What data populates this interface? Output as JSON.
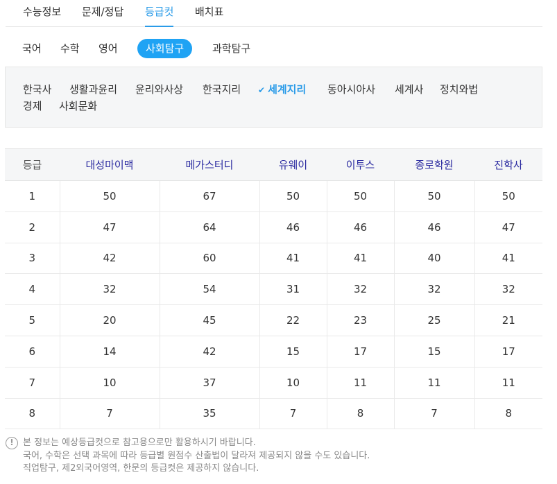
{
  "top_tabs": [
    "수능정보",
    "문제/정답",
    "등급컷",
    "배치표"
  ],
  "active_top_tab": "등급컷",
  "subjects": [
    "국어",
    "수학",
    "영어",
    "사회탐구",
    "과학탐구"
  ],
  "active_subject": "사회탐구",
  "sub_subjects": [
    "한국사",
    "생활과윤리",
    "윤리와사상",
    "한국지리",
    "세계지리",
    "동아시아사",
    "세계사",
    "정치와법",
    "경제",
    "사회문화"
  ],
  "active_sub_subject": "세계지리",
  "check_icon": "✔",
  "table": {
    "headers": [
      "등급",
      "대성마이맥",
      "메가스터디",
      "유웨이",
      "이투스",
      "종로학원",
      "진학사"
    ],
    "rows": [
      [
        "1",
        "50",
        "67",
        "50",
        "50",
        "50",
        "50"
      ],
      [
        "2",
        "47",
        "64",
        "46",
        "46",
        "46",
        "47"
      ],
      [
        "3",
        "42",
        "60",
        "41",
        "41",
        "40",
        "41"
      ],
      [
        "4",
        "32",
        "54",
        "31",
        "32",
        "32",
        "32"
      ],
      [
        "5",
        "20",
        "45",
        "22",
        "23",
        "25",
        "21"
      ],
      [
        "6",
        "14",
        "42",
        "15",
        "17",
        "15",
        "17"
      ],
      [
        "7",
        "10",
        "37",
        "10",
        "11",
        "11",
        "11"
      ],
      [
        "8",
        "7",
        "35",
        "7",
        "8",
        "7",
        "8"
      ]
    ]
  },
  "notice_icon": "!",
  "notes": [
    "본 정보는 예상등급컷으로 참고용으로만 활용하시기 바랍니다.",
    "국어, 수학은 선택 과목에 따라 등급별 원점수 산출법이 달라져 제공되지 않을 수도 있습니다.",
    "직업탐구, 제2외국어영역, 한문의 등급컷은 제공하지 않습니다."
  ],
  "colors": {
    "accent": "#1fa3f4",
    "header_text": "#2a2aa0",
    "active_text": "#2a9be8"
  }
}
